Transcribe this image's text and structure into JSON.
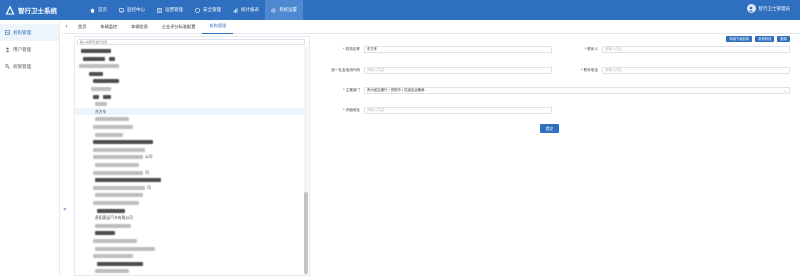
{
  "header": {
    "brand": "智行卫士系统",
    "nav": [
      {
        "label": "首页",
        "icon": "home-icon"
      },
      {
        "label": "监控中心",
        "icon": "monitor-icon"
      },
      {
        "label": "运营管理",
        "icon": "operations-icon"
      },
      {
        "label": "安全管理",
        "icon": "safety-icon"
      },
      {
        "label": "统计报表",
        "icon": "report-icon"
      },
      {
        "label": "系统设置",
        "icon": "settings-icon"
      }
    ],
    "active_nav": "系统设置",
    "user": "智行卫士管理员"
  },
  "sidebar": {
    "items": [
      {
        "label": "机构管理",
        "icon": "org-icon"
      },
      {
        "label": "用户管理",
        "icon": "user-icon"
      },
      {
        "label": "权限管理",
        "icon": "permission-icon"
      }
    ],
    "active": "机构管理",
    "collapse_symbol": "«"
  },
  "tabs": {
    "items": [
      "首页",
      "车辆监控",
      "车辆信息",
      "企业评分标准配置",
      "机构管理"
    ],
    "active": "机构管理"
  },
  "tree": {
    "search_placeholder": "输入关键字进行过滤",
    "rows": [
      {
        "text": "",
        "selected": false
      },
      {
        "text": "",
        "selected": false
      },
      {
        "text": "",
        "selected": false
      },
      {
        "text": "",
        "selected": false
      },
      {
        "text": "",
        "selected": false
      },
      {
        "text": "",
        "selected": false
      },
      {
        "text": "",
        "selected": false
      },
      {
        "text": "",
        "selected": false
      },
      {
        "text": "东方车",
        "selected": true
      },
      {
        "text": "",
        "selected": false
      },
      {
        "text": "",
        "selected": false
      },
      {
        "text": "",
        "selected": false
      },
      {
        "text": "",
        "selected": false
      },
      {
        "text": "",
        "selected": false
      },
      {
        "text": "公司",
        "selected": false
      },
      {
        "text": "",
        "selected": false
      },
      {
        "text": "司",
        "selected": false
      },
      {
        "text": "",
        "selected": false
      },
      {
        "text": "司",
        "selected": false
      },
      {
        "text": "",
        "selected": false
      },
      {
        "text": "",
        "selected": false
      },
      {
        "text": "",
        "selected": false
      },
      {
        "text": "贵阳客运汽车有限公司",
        "selected": false
      },
      {
        "text": "",
        "selected": false
      },
      {
        "text": "",
        "selected": false
      },
      {
        "text": "",
        "selected": false
      },
      {
        "text": "",
        "selected": false
      },
      {
        "text": "",
        "selected": false
      },
      {
        "text": "",
        "selected": false
      },
      {
        "text": "",
        "selected": false
      }
    ]
  },
  "form": {
    "buttons": [
      "新增下级机构",
      "机构修改",
      "删除"
    ],
    "fields": {
      "org_name": {
        "label": "机构名称",
        "required": true,
        "value": "东方车"
      },
      "contact": {
        "label": "联系人",
        "required": true,
        "placeholder": "请输入内容"
      },
      "credit_code": {
        "label": "统一社会信用代码",
        "required": false,
        "placeholder": "请输入内容"
      },
      "phone": {
        "label": "联系电话",
        "required": true,
        "placeholder": "请输入内容"
      },
      "authority": {
        "label": "主管部门",
        "required": true,
        "value": "贵州省交通厅 / 贵阳市 / 花溪区运输局"
      },
      "address": {
        "label": "详细地址",
        "required": true,
        "placeholder": "请输入内容"
      }
    },
    "submit_label": "提交"
  },
  "colors": {
    "primary": "#2f6fbf",
    "active_nav_bg": "#4d88d0",
    "required": "#e03c3c"
  }
}
